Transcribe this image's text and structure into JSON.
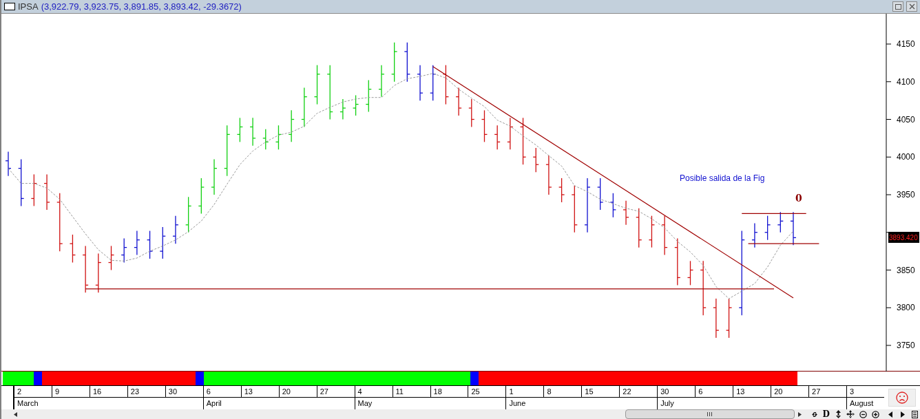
{
  "window": {
    "title": "IPSA",
    "values": "(3,922.79, 3,923.75, 3,891.85, 3,893.42, -29.3672)"
  },
  "chart": {
    "y_labels": [
      "4150",
      "4100",
      "4050",
      "4000",
      "3950",
      "3850",
      "3800",
      "3750"
    ],
    "annotation": "Posible salida de la Fig",
    "marker": "0",
    "price_label": "3893.420"
  },
  "trend_strip": [
    {
      "color": "#00ff00"
    },
    {
      "color": "#0000ff"
    },
    {
      "color": "#ff0000"
    },
    {
      "color": "#0000ff"
    },
    {
      "color": "#00ff00"
    },
    {
      "color": "#0000ff"
    },
    {
      "color": "#ff0000"
    }
  ],
  "date_axis": [
    {
      "day": "2",
      "month": "March"
    },
    {
      "day": "9"
    },
    {
      "day": "16"
    },
    {
      "day": "23"
    },
    {
      "day": "30"
    },
    {
      "day": "6",
      "month": "April"
    },
    {
      "day": "13"
    },
    {
      "day": "20"
    },
    {
      "day": "27"
    },
    {
      "day": "4",
      "month": "May"
    },
    {
      "day": "11"
    },
    {
      "day": "18"
    },
    {
      "day": "25"
    },
    {
      "day": "1",
      "month": "June"
    },
    {
      "day": "8"
    },
    {
      "day": "15"
    },
    {
      "day": "22"
    },
    {
      "day": "30",
      "month": "July"
    },
    {
      "day": "6"
    },
    {
      "day": "13"
    },
    {
      "day": "20"
    },
    {
      "day": "27"
    },
    {
      "day": "3",
      "month": "August"
    }
  ],
  "toolbar": {
    "d_button": "D"
  }
}
